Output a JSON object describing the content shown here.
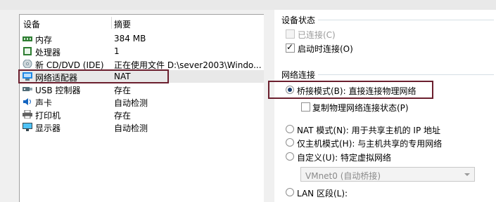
{
  "device_list": {
    "col_device": "设备",
    "col_summary": "摘要",
    "rows": [
      {
        "name": "内存",
        "summary": "384 MB",
        "icon": "memory-icon"
      },
      {
        "name": "处理器",
        "summary": "1",
        "icon": "cpu-icon"
      },
      {
        "name": "新 CD/DVD (IDE)",
        "summary": "正在使用文件 D:\\sever2003\\Windo...",
        "icon": "cd-dvd-icon"
      },
      {
        "name": "网络适配器",
        "summary": "NAT",
        "icon": "network-adapter-icon"
      },
      {
        "name": "USB 控制器",
        "summary": "存在",
        "icon": "usb-icon"
      },
      {
        "name": "声卡",
        "summary": "自动检测",
        "icon": "sound-icon"
      },
      {
        "name": "打印机",
        "summary": "存在",
        "icon": "printer-icon"
      },
      {
        "name": "显示器",
        "summary": "自动检测",
        "icon": "monitor-icon"
      }
    ]
  },
  "device_status": {
    "title": "设备状态",
    "connected_label": "已连接(C)",
    "connected_checked": false,
    "connect_on_power_label": "启动时连接(O)",
    "connect_on_power_checked": true
  },
  "network_connection": {
    "title": "网络连接",
    "bridged_label": "桥接模式(B): 直接连接物理网络",
    "replicate_label": "复制物理网络连接状态(P)",
    "nat_label": "NAT 模式(N): 用于共享主机的 IP 地址",
    "hostonly_label": "仅主机模式(H): 与主机共享的专用网络",
    "custom_label": "自定义(U): 特定虚拟网络",
    "custom_select_value": "VMnet0 (自动桥接)",
    "lan_label": "LAN 区段(L):",
    "selected": "bridged"
  },
  "colors": {
    "annotation": "#6b1f2e",
    "radio_dot": "#1a3d6d"
  }
}
